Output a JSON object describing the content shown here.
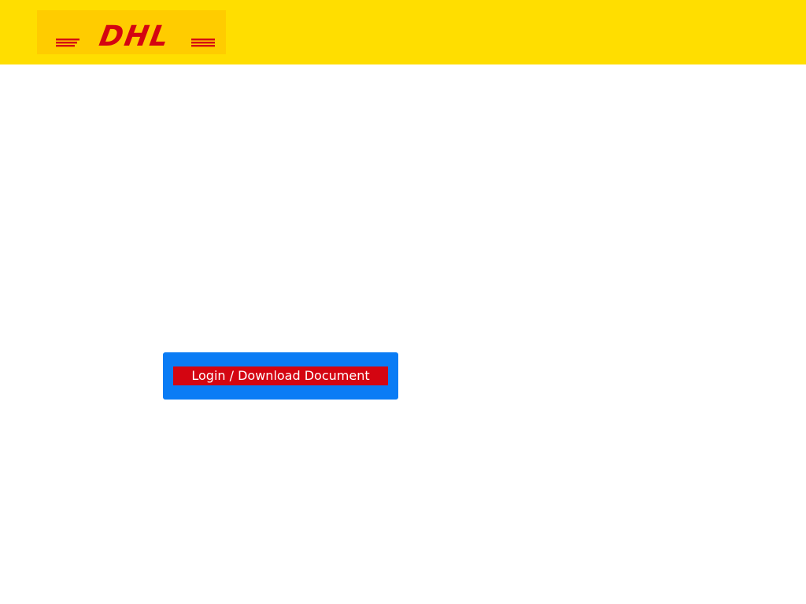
{
  "header": {
    "logo": {
      "text": "DHL",
      "icon": "dhl-logo",
      "background_color": "#ffcc00",
      "text_color": "#d40511"
    },
    "background_color": "#ffde00"
  },
  "main": {
    "cta": {
      "label": "Login / Download Document",
      "frame_color": "#0a7cf5",
      "button_color": "#d40511",
      "text_color": "#ffffff"
    }
  }
}
